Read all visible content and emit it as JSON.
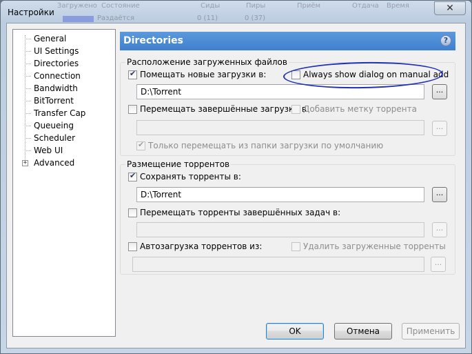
{
  "window": {
    "title": "Настройки",
    "close_glyph": "✕"
  },
  "background_ui": {
    "column_headers": [
      "Загружено",
      "Состояние",
      "Сиды",
      "Пиры",
      "Приём",
      "Отдача",
      "Время"
    ],
    "row_values": [
      "Раздаётся",
      "0 (11)",
      "0 (37)"
    ]
  },
  "sidebar": {
    "items": [
      {
        "label": "General"
      },
      {
        "label": "UI Settings"
      },
      {
        "label": "Directories",
        "selected": true
      },
      {
        "label": "Connection"
      },
      {
        "label": "Bandwidth"
      },
      {
        "label": "BitTorrent"
      },
      {
        "label": "Transfer Cap"
      },
      {
        "label": "Queueing"
      },
      {
        "label": "Scheduler"
      },
      {
        "label": "Web UI"
      },
      {
        "label": "Advanced",
        "expandable": true,
        "expander_glyph": "+"
      }
    ]
  },
  "header": {
    "title": "Directories",
    "help_glyph": "?"
  },
  "downloads_group": {
    "title": "Расположение загруженных файлов",
    "put_new_label": "Помещать новые загрузки в:",
    "put_new_checked": true,
    "always_show_label": "Always show dialog on manual add",
    "always_show_checked": false,
    "download_path": "D:\\Torrent",
    "move_completed_label": "Перемещать завершённые загрузки в",
    "move_completed_checked": false,
    "add_label_label": "Добавить метку торрента",
    "add_label_checked": false,
    "move_completed_path": "",
    "only_move_default_label": "Только перемещать из папки загрузки по умолчанию",
    "only_move_default_checked": true,
    "browse_label": "..."
  },
  "torrents_group": {
    "title": "Размещение торрентов",
    "store_label": "Сохранять торренты в:",
    "store_checked": true,
    "store_path": "D:\\Torrent",
    "move_finished_label": "Перемещать торренты завершённых задач в:",
    "move_finished_checked": false,
    "move_finished_path": "",
    "autoload_label": "Автозагрузка торрентов из:",
    "autoload_checked": false,
    "delete_loaded_label": "Удалить загруженные торренты",
    "delete_loaded_checked": false,
    "autoload_path": "",
    "browse_label": "..."
  },
  "buttons": {
    "ok": "OK",
    "cancel": "Отмена",
    "apply": "Применить"
  },
  "colors": {
    "header_blue": "#4a8ad6",
    "annotation_ellipse": "#1f2fb8"
  }
}
